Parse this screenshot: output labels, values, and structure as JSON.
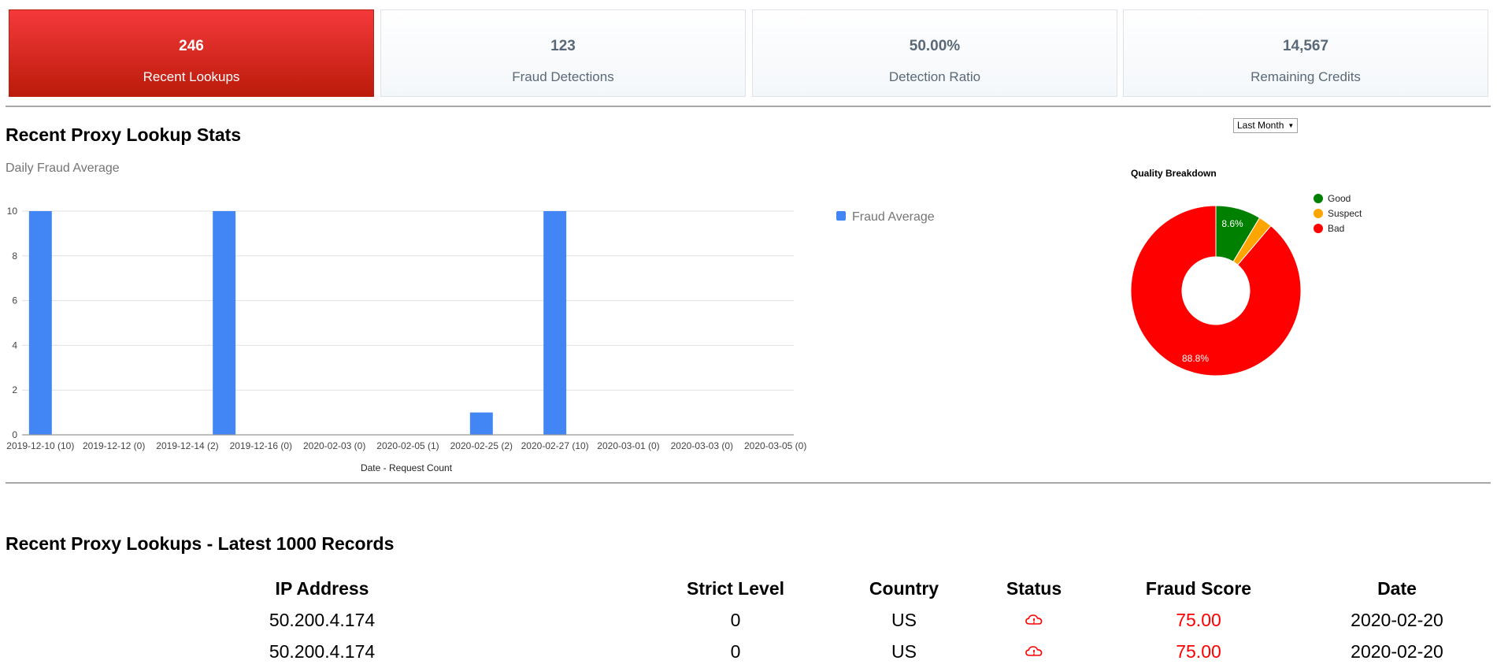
{
  "stats": [
    {
      "value": "246",
      "label": "Recent Lookups",
      "primary": true
    },
    {
      "value": "123",
      "label": "Fraud Detections",
      "primary": false
    },
    {
      "value": "50.00%",
      "label": "Detection Ratio",
      "primary": false
    },
    {
      "value": "14,567",
      "label": "Remaining Credits",
      "primary": false
    }
  ],
  "stats_section": {
    "title": "Recent Proxy Lookup Stats",
    "range_select": {
      "selected": "Last Month",
      "icon": "dropdown-arrow-icon"
    }
  },
  "colors": {
    "primary_card": "#e0241c",
    "bar": "#4285f4",
    "good": "#008000",
    "suspect": "#ffa500",
    "bad": "#ff0000",
    "fraud_score": "#ff0000"
  },
  "chart_data": [
    {
      "type": "bar",
      "title": "Daily Fraud Average",
      "xlabel": "Date - Request Count",
      "ylabel": "",
      "ylim": [
        0,
        10
      ],
      "yticks": [
        0,
        2,
        4,
        6,
        8,
        10
      ],
      "grid": true,
      "legend": {
        "position": "right",
        "entries": [
          "Fraud Average"
        ]
      },
      "categories": [
        "2019-12-10 (10)",
        null,
        "2019-12-12 (0)",
        null,
        "2019-12-14 (2)",
        null,
        "2019-12-16 (0)",
        null,
        "2020-02-03 (0)",
        null,
        "2020-02-05 (1)",
        null,
        "2020-02-25 (2)",
        null,
        "2020-02-27 (10)",
        null,
        "2020-03-01 (0)",
        null,
        "2020-03-03 (0)",
        null,
        "2020-03-05 (0)"
      ],
      "series": [
        {
          "name": "Fraud Average",
          "values": [
            10,
            0,
            0,
            0,
            0,
            10,
            0,
            0,
            0,
            0,
            0,
            0,
            1,
            0,
            10,
            0,
            0,
            0,
            0,
            0,
            0
          ]
        }
      ]
    },
    {
      "type": "pie",
      "title": "Quality Breakdown",
      "donut": true,
      "legend": {
        "position": "right"
      },
      "slices": [
        {
          "label": "Good",
          "value": 8.6,
          "display": "8.6%"
        },
        {
          "label": "Suspect",
          "value": 2.6,
          "display": ""
        },
        {
          "label": "Bad",
          "value": 88.8,
          "display": "88.8%"
        }
      ]
    }
  ],
  "lookups": {
    "title": "Recent Proxy Lookups - Latest 1000 Records",
    "columns": [
      "IP Address",
      "Strict Level",
      "Country",
      "Status",
      "Fraud Score",
      "Date"
    ],
    "rows": [
      {
        "ip": "50.200.4.174",
        "strict_level": "0",
        "country": "US",
        "status_icon": "cloud-alert-icon",
        "fraud_score": "75.00",
        "date": "2020-02-20"
      },
      {
        "ip": "50.200.4.174",
        "strict_level": "0",
        "country": "US",
        "status_icon": "cloud-alert-icon",
        "fraud_score": "75.00",
        "date": "2020-02-20"
      }
    ]
  }
}
